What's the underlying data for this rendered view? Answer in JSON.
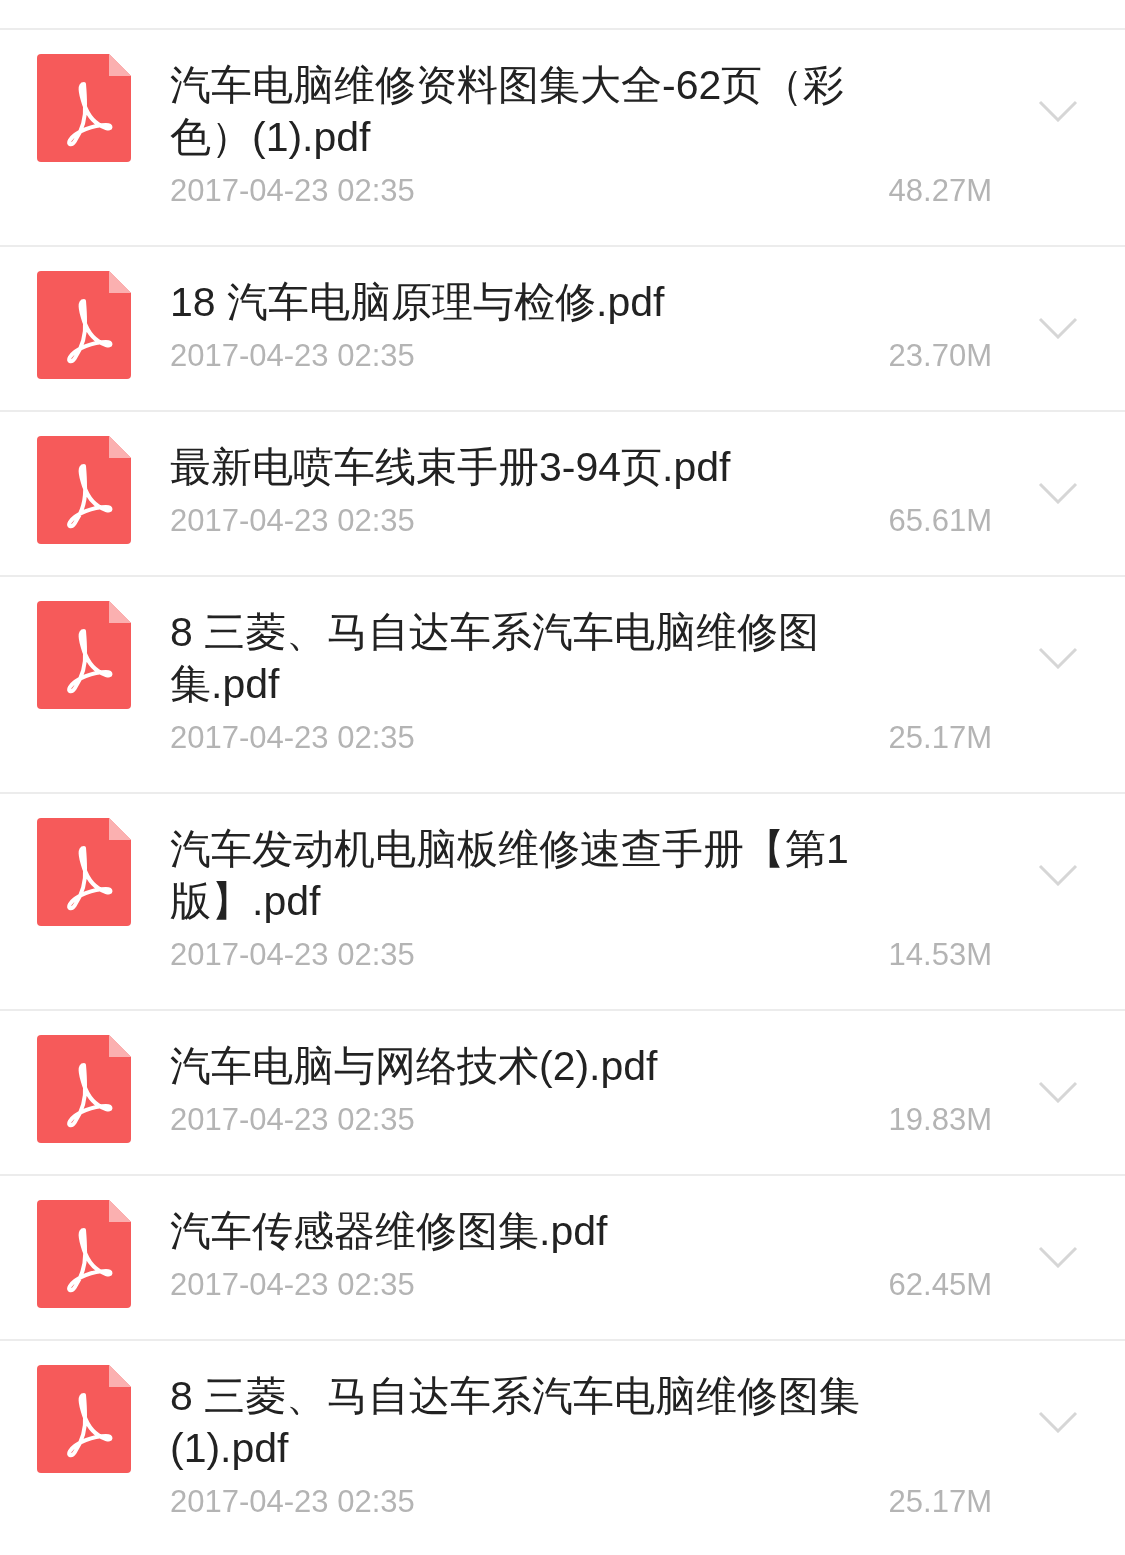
{
  "files": [
    {
      "title": "汽车电脑维修资料图集大全-62页（彩色）(1).pdf",
      "date": "2017-04-23 02:35",
      "size": "48.27M"
    },
    {
      "title": "18 汽车电脑原理与检修.pdf",
      "date": "2017-04-23 02:35",
      "size": "23.70M"
    },
    {
      "title": "最新电喷车线束手册3-94页.pdf",
      "date": "2017-04-23 02:35",
      "size": "65.61M"
    },
    {
      "title": "8 三菱、马自达车系汽车电脑维修图集.pdf",
      "date": "2017-04-23 02:35",
      "size": "25.17M"
    },
    {
      "title": "汽车发动机电脑板维修速查手册【第1版】.pdf",
      "date": "2017-04-23 02:35",
      "size": "14.53M"
    },
    {
      "title": "汽车电脑与网络技术(2).pdf",
      "date": "2017-04-23 02:35",
      "size": "19.83M"
    },
    {
      "title": "汽车传感器维修图集.pdf",
      "date": "2017-04-23 02:35",
      "size": "62.45M"
    },
    {
      "title": "8 三菱、马自达车系汽车电脑维修图集(1).pdf",
      "date": "2017-04-23 02:35",
      "size": "25.17M"
    }
  ]
}
